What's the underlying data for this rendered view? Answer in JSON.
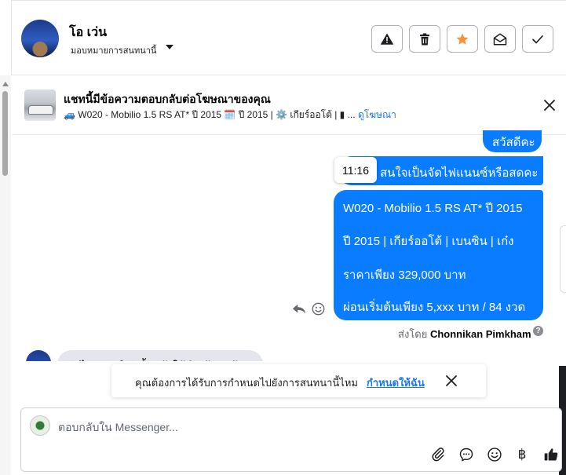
{
  "conversation": {
    "name": "โอ เว่น",
    "assign_label": "มอบหมายการสนทนานี้"
  },
  "actions": [
    {
      "name": "report-button",
      "icon": "warning-icon"
    },
    {
      "name": "delete-button",
      "icon": "trash-icon"
    },
    {
      "name": "star-button",
      "icon": "star-icon",
      "color": "#f7923b"
    },
    {
      "name": "mark-unread-button",
      "icon": "envelope-open-icon"
    },
    {
      "name": "mark-done-button",
      "icon": "check-icon"
    }
  ],
  "ad_context": {
    "title": "แชทนี้มีข้อความตอบกลับต่อโฆษณาของคุณ",
    "subtitle": "🚙 W020 - Mobilio 1.5 RS AT* ปี 2015 🗓️ ปี 2015 | ⚙️ เกียร์ออโต้ | ▮ ...",
    "link_label": "ดูโฆษณา"
  },
  "messages": {
    "greeting": "สวัสดีคะ",
    "question": "สนใจเป็นจัดไฟแนนซ์หรือสดคะ",
    "tooltip_time": "11:16",
    "offer_lines": [
      "W020 - Mobilio 1.5 RS AT* ปี 2015",
      "ปี 2015 |  เกียร์ออโต้ | เบนซิน |  เก๋ง",
      "ราคาเพียง 329,000 บาท",
      "ผ่อนเริ่มต้นเพียง 5,xxx บาท / 84 งวด"
    ],
    "sent_by_prefix": "ส่งโดย",
    "sent_by_name": "Chonnikan Pimkham",
    "help_glyph": "?",
    "incoming_partial": "จัดไฟแนนซ์ ดังนั้นแจ้งให้นำเข้ามาข้อมูลกัน"
  },
  "banner": {
    "text": "คุณต้องการได้รับการกำหนดไปยังการสนทนานี้ไหม",
    "link": "กำหนดให้ฉัน"
  },
  "composer": {
    "placeholder": "ตอบกลับใน Messenger...",
    "currency_glyph": "฿"
  },
  "colors": {
    "bubble": "#0a7cff",
    "accent": "#1877f2",
    "star": "#f7923b"
  }
}
